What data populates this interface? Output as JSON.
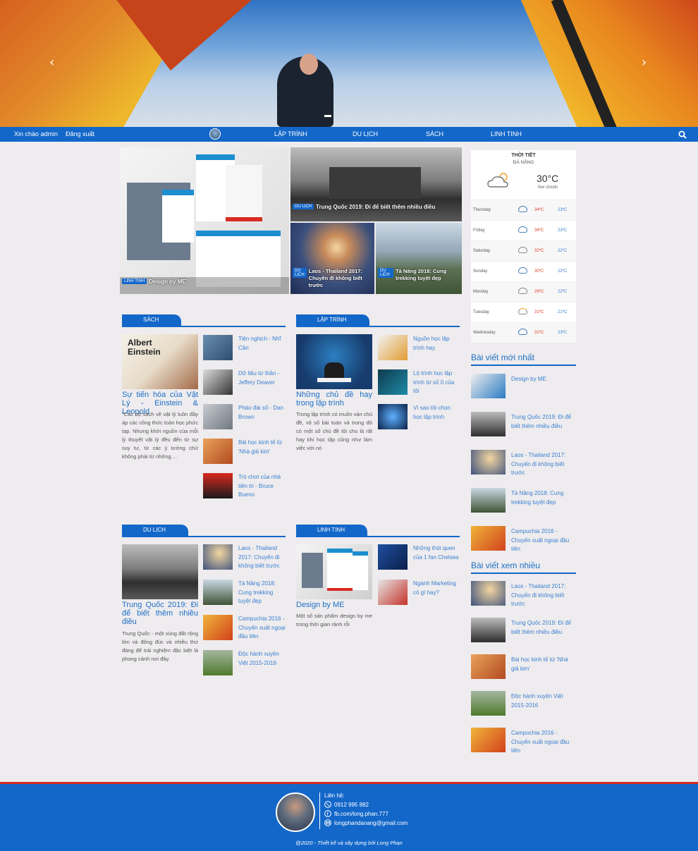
{
  "hero": {
    "prev_arrow": "‹",
    "next_arrow": "›"
  },
  "nav": {
    "greeting": "Xin chào admin",
    "logout": "Đăng xuất",
    "menu": [
      "LẬP TRÌNH",
      "DU LỊCH",
      "SÁCH",
      "LINH TINH"
    ],
    "search_icon": "search-icon"
  },
  "featured": [
    {
      "tag": "LINH TINH",
      "title": "Design by ME"
    },
    {
      "tag": "DU LỊCH",
      "title": "Trung Quốc 2019: Đi để biết thêm nhiều điều"
    },
    {
      "tag": "DU LỊCH",
      "title": "Laos - Thailand 2017: Chuyến đi không biết trước"
    },
    {
      "tag": "DU LỊCH",
      "title": "Tà Năng 2018: Cung trekking tuyệt đẹp"
    }
  ],
  "sections": [
    {
      "label": "SÁCH",
      "main_title": "Sự tiến hóa của Vật Lý - Einstein & Leopold",
      "main_desc": "\"Các bộ sách về vật lý luôn đầy áp các công thức toán học phức tạp. Nhưng khởi nguồn của mỗi lý thuyết vật lý đều đến từ sự suy tư, từ các ý tưởng chứ không phải từ những ...",
      "items": [
        "Tiện nghịch - Nhĩ Căn",
        "Dữ liệu từ thần - Jeffery Deaver",
        "Pháo đài số - Dan Brown",
        "Bài học kinh tế từ 'Nhà giả kim'",
        "Trò chơi của nhà tiên tri - Bruce Bueno"
      ]
    },
    {
      "label": "LẬP TRÌNH",
      "main_title": "Những chủ đề hay trong lập trình",
      "main_desc": "Trong lập trình có muôn vàn chủ đề, vô số bài toán và trong đó có một số chủ đề tôi cho là rất hay khi học tập cũng như làm việc với nó",
      "items": [
        "Nguồn học lập trình hay",
        "Lộ trình học lập trình từ số 0 của tôi",
        "Vì sao tôi chọn học lập trình"
      ]
    },
    {
      "label": "DU LỊCH",
      "main_title": "Trung Quốc 2019: Đi để biết thêm nhiều điều",
      "main_desc": "Trung Quốc - một vùng đất rộng lớn và đông đúc và nhiều thứ đáng để trải nghiệm đặc biệt là phong cảnh nơi đây.",
      "items": [
        "Laos - Thailand 2017: Chuyến đi không biết trước",
        "Tà Năng 2018: Cung trekking tuyệt đẹp",
        "Campuchia 2016 - Chuyến xuất ngoại đầu tiên",
        "Độc hành xuyên Việt 2015-2016"
      ]
    },
    {
      "label": "LINH TINH",
      "main_title": "Design by ME",
      "main_desc": "Một số sản phẩm design by me trong thời gian rảnh rỗi",
      "items": [
        "Những thói quen của 1 fan Chelsea",
        "Ngành Marketing có gì hay?"
      ]
    }
  ],
  "weather": {
    "title": "THỜI TIẾT",
    "city": "ĐÀ NẴNG",
    "temp": "30°C",
    "desc": "few clouds",
    "days": [
      {
        "day": "Thursday",
        "hi": "34ºC",
        "lo": "23ºC",
        "icon": "rain"
      },
      {
        "day": "Friday",
        "hi": "34ºC",
        "lo": "23ºC",
        "icon": "rain"
      },
      {
        "day": "Saturday",
        "hi": "32ºC",
        "lo": "22ºC",
        "icon": "cloud"
      },
      {
        "day": "Sunday",
        "hi": "30ºC",
        "lo": "22ºC",
        "icon": "rain"
      },
      {
        "day": "Monday",
        "hi": "29ºC",
        "lo": "22ºC",
        "icon": "cloud"
      },
      {
        "day": "Tuesday",
        "hi": "31ºC",
        "lo": "21ºC",
        "icon": "sun-cloud"
      },
      {
        "day": "Wednesday",
        "hi": "31ºC",
        "lo": "23ºC",
        "icon": "rain"
      }
    ]
  },
  "latest": {
    "title": "Bài viết mới nhất",
    "items": [
      "Design by ME",
      "Trung Quốc 2019: Đi để biết thêm nhiều điều",
      "Laos - Thailand 2017: Chuyến đi không biết trước",
      "Tà Năng 2018: Cung trekking tuyệt đẹp",
      "Campuchia 2016 - Chuyến xuất ngoại đầu tiên"
    ]
  },
  "popular": {
    "title": "Bài viết xem nhiều",
    "items": [
      "Laos - Thailand 2017: Chuyến đi không biết trước",
      "Trung Quốc 2019: Đi để biết thêm nhiều điều",
      "Bài học kinh tế từ 'Nhà giả kim'",
      "Độc hành xuyên Việt 2015-2016",
      "Campuchia 2016 - Chuyến xuất ngoại đầu tiên"
    ]
  },
  "footer": {
    "contact_label": "Liên hệ:",
    "phone": "0912 995 882",
    "facebook": "fb.com/long.phan.777",
    "email": "longphandanang@gmail.com",
    "copyright": "@2020 - Thiết kế và xây dựng bởi Long Phan"
  },
  "colors": {
    "brand": "#1367c9",
    "footer_line": "#d82a20",
    "hot_temp": "#e0402b",
    "cold_temp": "#3a7fd1"
  }
}
